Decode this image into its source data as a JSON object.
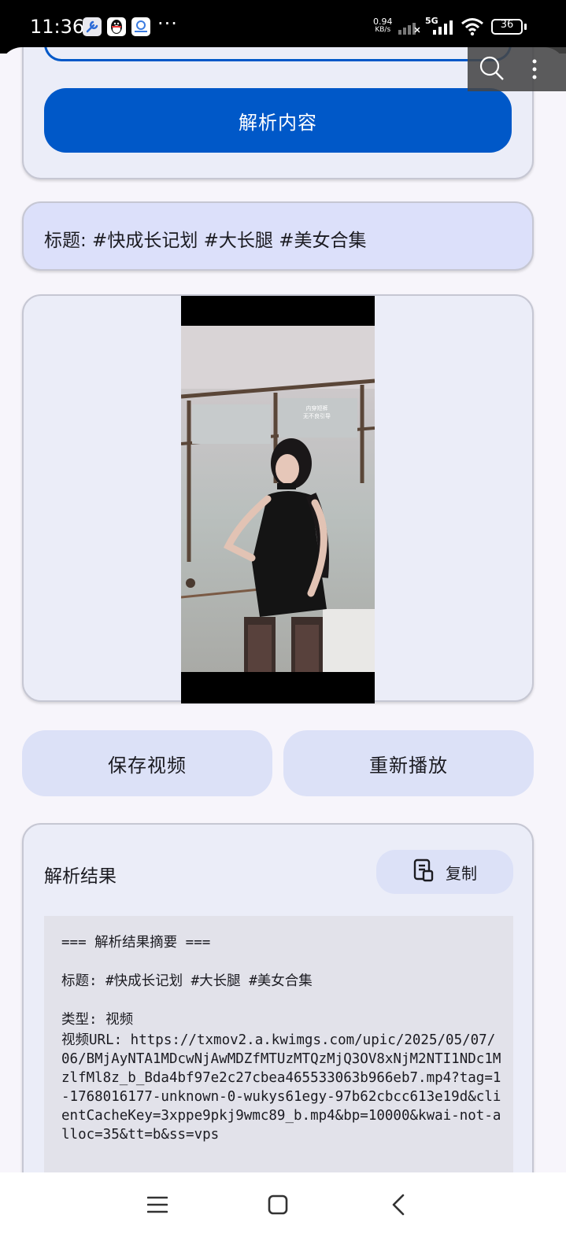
{
  "status_bar": {
    "time": "11:36",
    "app_icons": [
      "wrench-icon",
      "qq-penguin-icon",
      "cloud-app-icon"
    ],
    "more": "···",
    "net_speed_value": "0.94",
    "net_speed_unit": "KB/s",
    "signal_label": "5G",
    "battery_level": "36"
  },
  "input_section": {
    "parse_button_label": "解析内容"
  },
  "title_section": {
    "title": "标题: #快成长记划  #大长腿  #美女合集"
  },
  "video_section": {
    "overlay_text_line1": "内穿短裤",
    "overlay_text_line2": "无不良引导"
  },
  "actions": {
    "save_label": "保存视频",
    "replay_label": "重新播放"
  },
  "result_section": {
    "heading": "解析结果",
    "copy_label": "复制",
    "summary_header": "=== 解析结果摘要 ===",
    "title_line": "标题: #快成长记划  #大长腿  #美女合集",
    "type_line": "类型: 视频",
    "url_line": "视频URL: https://txmov2.a.kwimgs.com/upic/2025/05/07/06/BMjAyNTA1MDcwNjAwMDZfMTUzMTQzMjQ3OV8xNjM2NTI1NDc1MzlfMl8z_b_Bda4bf97e2c27cbea465533063b966eb7.mp4?tag=1-1768016177-unknown-0-wukys61egy-97b62cbcc613e19d&clientCacheKey=3xppe9pkj9wmc89_b.mp4&bp=10000&kwai-not-alloc=35&tt=b&ss=vps"
  },
  "colors": {
    "primary": "#0058c8",
    "card_bg": "#ebedf8",
    "tonal_bg": "#dce1f7",
    "result_bg": "#e2e2ea"
  },
  "nav_bar": {
    "icons": [
      "menu-icon",
      "home-icon",
      "back-icon"
    ]
  }
}
